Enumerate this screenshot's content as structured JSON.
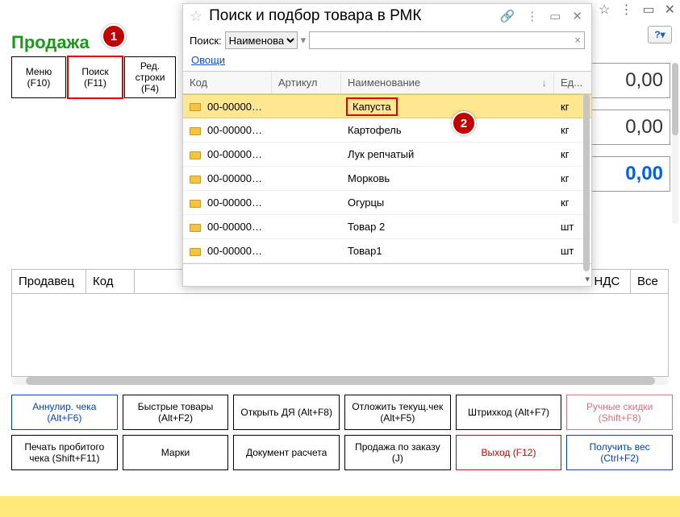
{
  "title": "Продажа",
  "toolbar": {
    "menu": "Меню (F10)",
    "search": "Поиск (F11)",
    "edit": "Ред. строки (F4)"
  },
  "amounts": {
    "a1": "0,00",
    "a2": "0,00",
    "a3": "0,00"
  },
  "main_cols": {
    "seller": "Продавец",
    "code": "Код",
    "nds": "а НДС",
    "total": "Все"
  },
  "help_label": "?",
  "bottom": {
    "r1": {
      "annul": "Аннулир. чека (Alt+F6)",
      "fast": "Быстрые товары (Alt+F2)",
      "drawer": "Открыть ДЯ (Alt+F8)",
      "postpone": "Отложить текущ.чек (Alt+F5)",
      "barcode": "Штрихкод (Alt+F7)",
      "manual": "Ручные скидки (Shift+F8)"
    },
    "r2": {
      "print": "Печать пробитого чека (Shift+F11)",
      "marks": "Марки",
      "doc": "Документ расчета",
      "order": "Продажа по заказу (J)",
      "exit": "Выход (F12)",
      "weight": "Получить вес (Ctrl+F2)"
    }
  },
  "dialog": {
    "title": "Поиск и подбор товара в РМК",
    "search_label": "Поиск:",
    "search_mode": "Наименова",
    "breadcrumb": "Овощи",
    "cols": {
      "code": "Код",
      "art": "Артикул",
      "name": "Наименование",
      "unit": "Ед..."
    },
    "rows": [
      {
        "code": "00-00000…",
        "art": "",
        "name": "Капуста",
        "unit": "кг",
        "sel": true
      },
      {
        "code": "00-00000…",
        "art": "",
        "name": "Картофель",
        "unit": "кг"
      },
      {
        "code": "00-00000…",
        "art": "",
        "name": "Лук репчатый",
        "unit": "кг"
      },
      {
        "code": "00-00000…",
        "art": "",
        "name": "Морковь",
        "unit": "кг"
      },
      {
        "code": "00-00000…",
        "art": "",
        "name": "Огурцы",
        "unit": "кг"
      },
      {
        "code": "00-00000…",
        "art": "",
        "name": "Товар 2",
        "unit": "шт"
      },
      {
        "code": "00-00000…",
        "art": "",
        "name": "Товар1",
        "unit": "шт"
      }
    ]
  },
  "badges": {
    "b1": "1",
    "b2": "2"
  }
}
